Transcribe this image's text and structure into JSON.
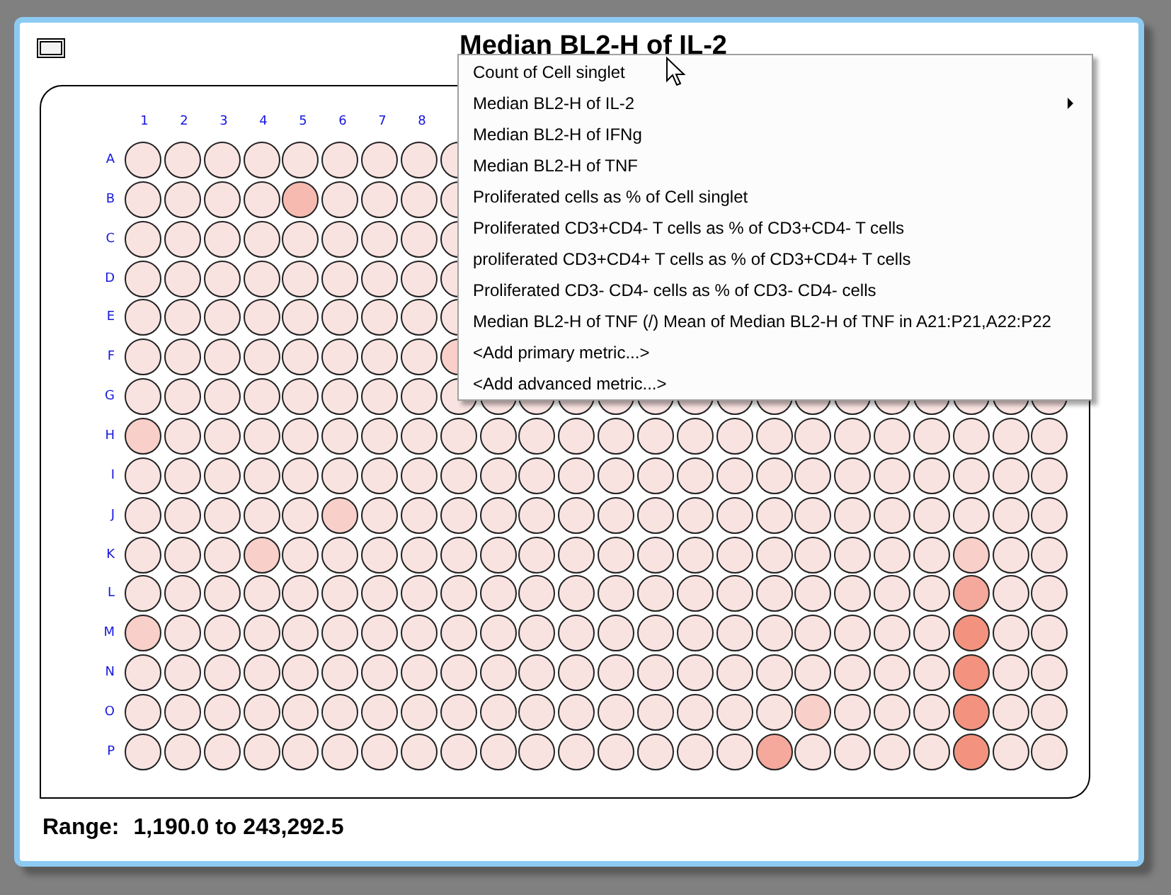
{
  "window": {
    "title": "Median BL2-H of IL-2"
  },
  "plate": {
    "column_labels": [
      "1",
      "2",
      "3",
      "4",
      "5",
      "6",
      "7",
      "8"
    ],
    "rows": [
      {
        "label": "A",
        "wells": [
          {
            "color": "#f9e3e1"
          },
          {
            "color": "#f9e3e1"
          },
          {
            "color": "#f9e3e1"
          },
          {
            "color": "#f9e3e1"
          },
          {
            "color": "#f9e3e1"
          },
          {
            "color": "#f9e3e1"
          },
          {
            "color": "#f9e3e1"
          },
          {
            "color": "#f9e3e1"
          },
          {
            "color": "#f9e3e1"
          }
        ]
      },
      {
        "label": "B",
        "wells": [
          {
            "color": "#f9e3e1"
          },
          {
            "color": "#f9e3e1"
          },
          {
            "color": "#f9e3e1"
          },
          {
            "color": "#f9e3e1"
          },
          {
            "color": "#f7bab0"
          },
          {
            "color": "#f9e3e1"
          },
          {
            "color": "#f9e3e1"
          },
          {
            "color": "#f9e3e1"
          },
          {
            "color": "#f9e3e1"
          }
        ]
      },
      {
        "label": "C",
        "wells": [
          {
            "color": "#f9e3e1"
          },
          {
            "color": "#f9e3e1"
          },
          {
            "color": "#f9e3e1"
          },
          {
            "color": "#f9e3e1"
          },
          {
            "color": "#f9e3e1"
          },
          {
            "color": "#f9e3e1"
          },
          {
            "color": "#f9e3e1"
          },
          {
            "color": "#f9e3e1"
          },
          {
            "color": "#f9e3e1"
          }
        ]
      },
      {
        "label": "D",
        "wells": [
          {
            "color": "#f9e3e1"
          },
          {
            "color": "#f9e3e1"
          },
          {
            "color": "#f9e3e1"
          },
          {
            "color": "#f9e3e1"
          },
          {
            "color": "#f9e3e1"
          },
          {
            "color": "#f9e3e1"
          },
          {
            "color": "#f9e3e1"
          },
          {
            "color": "#f9e3e1"
          },
          {
            "color": "#f9e3e1"
          }
        ]
      },
      {
        "label": "E",
        "wells": [
          {
            "color": "#f9e3e1"
          },
          {
            "color": "#f9e3e1"
          },
          {
            "color": "#f9e3e1"
          },
          {
            "color": "#f9e3e1"
          },
          {
            "color": "#f9e3e1"
          },
          {
            "color": "#f9e3e1"
          },
          {
            "color": "#f9e3e1"
          },
          {
            "color": "#f9e3e1"
          },
          {
            "color": "#f9e3e1"
          }
        ]
      },
      {
        "label": "F",
        "wells": [
          {
            "color": "#f9e3e1"
          },
          {
            "color": "#f9e3e1"
          },
          {
            "color": "#f9e3e1"
          },
          {
            "color": "#f9e3e1"
          },
          {
            "color": "#f9e3e1"
          },
          {
            "color": "#f9e3e1"
          },
          {
            "color": "#f9e3e1"
          },
          {
            "color": "#f9e3e1"
          },
          {
            "color": "#f8cfc9"
          }
        ]
      },
      {
        "label": "G",
        "wells": [
          {
            "color": "#f9e3e1"
          },
          {
            "color": "#f9e3e1"
          },
          {
            "color": "#f9e3e1"
          },
          {
            "color": "#f9e3e1"
          },
          {
            "color": "#f9e3e1"
          },
          {
            "color": "#f9e3e1"
          },
          {
            "color": "#f9e3e1"
          },
          {
            "color": "#f9e3e1"
          },
          {
            "color": "#f9e3e1"
          },
          {
            "color": "#f9e3e1"
          },
          {
            "color": "#f9e3e1"
          },
          {
            "color": "#f9e3e1"
          },
          {
            "color": "#f9e3e1"
          },
          {
            "color": "#f9e3e1"
          },
          {
            "color": "#f9e3e1"
          },
          {
            "color": "#f9e3e1"
          },
          {
            "color": "#f9e3e1"
          },
          {
            "color": "#f9e3e1"
          },
          {
            "color": "#f9e3e1"
          },
          {
            "color": "#f9e3e1"
          },
          {
            "color": "#f9e3e1"
          },
          {
            "color": "#f9e3e1"
          },
          {
            "color": "#f9e3e1"
          },
          {
            "color": "#f9e3e1"
          }
        ]
      },
      {
        "label": "H",
        "wells": [
          {
            "color": "#f8cfc9"
          },
          {
            "color": "#f9e3e1"
          },
          {
            "color": "#f9e3e1"
          },
          {
            "color": "#f9e3e1"
          },
          {
            "color": "#f9e3e1"
          },
          {
            "color": "#f9e3e1"
          },
          {
            "color": "#f9e3e1"
          },
          {
            "color": "#f9e3e1"
          },
          {
            "color": "#f9e3e1"
          },
          {
            "color": "#f9e3e1"
          },
          {
            "color": "#f9e3e1"
          },
          {
            "color": "#f9e3e1"
          },
          {
            "color": "#f9e3e1"
          },
          {
            "color": "#f9e3e1"
          },
          {
            "color": "#f9e3e1"
          },
          {
            "color": "#f9e3e1"
          },
          {
            "color": "#f9e3e1"
          },
          {
            "color": "#f9e3e1"
          },
          {
            "color": "#f9e3e1"
          },
          {
            "color": "#f9e3e1"
          },
          {
            "color": "#f9e3e1"
          },
          {
            "color": "#f9e3e1"
          },
          {
            "color": "#f9e3e1"
          },
          {
            "color": "#f9e3e1"
          }
        ]
      },
      {
        "label": "I",
        "wells": [
          {
            "color": "#f9e3e1"
          },
          {
            "color": "#f9e3e1"
          },
          {
            "color": "#f9e3e1"
          },
          {
            "color": "#f9e3e1"
          },
          {
            "color": "#f9e3e1"
          },
          {
            "color": "#f9e3e1"
          },
          {
            "color": "#f9e3e1"
          },
          {
            "color": "#f9e3e1"
          },
          {
            "color": "#f9e3e1"
          },
          {
            "color": "#f9e3e1"
          },
          {
            "color": "#f9e3e1"
          },
          {
            "color": "#f9e3e1"
          },
          {
            "color": "#f9e3e1"
          },
          {
            "color": "#f9e3e1"
          },
          {
            "color": "#f9e3e1"
          },
          {
            "color": "#f9e3e1"
          },
          {
            "color": "#f9e3e1"
          },
          {
            "color": "#f9e3e1"
          },
          {
            "color": "#f9e3e1"
          },
          {
            "color": "#f9e3e1"
          },
          {
            "color": "#f9e3e1"
          },
          {
            "color": "#f9e3e1"
          },
          {
            "color": "#f9e3e1"
          },
          {
            "color": "#f9e3e1"
          }
        ]
      },
      {
        "label": "J",
        "wells": [
          {
            "color": "#f9e3e1"
          },
          {
            "color": "#f9e3e1"
          },
          {
            "color": "#f9e3e1"
          },
          {
            "color": "#f9e3e1"
          },
          {
            "color": "#f9e3e1"
          },
          {
            "color": "#f8cfc9"
          },
          {
            "color": "#f9e3e1"
          },
          {
            "color": "#f9e3e1"
          },
          {
            "color": "#f9e3e1"
          },
          {
            "color": "#f9e3e1"
          },
          {
            "color": "#f9e3e1"
          },
          {
            "color": "#f9e3e1"
          },
          {
            "color": "#f9e3e1"
          },
          {
            "color": "#f9e3e1"
          },
          {
            "color": "#f9e3e1"
          },
          {
            "color": "#f9e3e1"
          },
          {
            "color": "#f9e3e1"
          },
          {
            "color": "#f9e3e1"
          },
          {
            "color": "#f9e3e1"
          },
          {
            "color": "#f9e3e1"
          },
          {
            "color": "#f9e3e1"
          },
          {
            "color": "#f9e3e1"
          },
          {
            "color": "#f9e3e1"
          },
          {
            "color": "#f9e3e1"
          }
        ]
      },
      {
        "label": "K",
        "wells": [
          {
            "color": "#f9e3e1"
          },
          {
            "color": "#f9e3e1"
          },
          {
            "color": "#f9e3e1"
          },
          {
            "color": "#f8cfc9"
          },
          {
            "color": "#f9e3e1"
          },
          {
            "color": "#f9e3e1"
          },
          {
            "color": "#f9e3e1"
          },
          {
            "color": "#f9e3e1"
          },
          {
            "color": "#f9e3e1"
          },
          {
            "color": "#f9e3e1"
          },
          {
            "color": "#f9e3e1"
          },
          {
            "color": "#f9e3e1"
          },
          {
            "color": "#f9e3e1"
          },
          {
            "color": "#f9e3e1"
          },
          {
            "color": "#f9e3e1"
          },
          {
            "color": "#f9e3e1"
          },
          {
            "color": "#f9e3e1"
          },
          {
            "color": "#f9e3e1"
          },
          {
            "color": "#f9e3e1"
          },
          {
            "color": "#f9e3e1"
          },
          {
            "color": "#f9e3e1"
          },
          {
            "color": "#f8cfc9"
          },
          {
            "color": "#f9e3e1"
          },
          {
            "color": "#f9e3e1"
          }
        ]
      },
      {
        "label": "L",
        "wells": [
          {
            "color": "#f9e3e1"
          },
          {
            "color": "#f9e3e1"
          },
          {
            "color": "#f9e3e1"
          },
          {
            "color": "#f9e3e1"
          },
          {
            "color": "#f9e3e1"
          },
          {
            "color": "#f9e3e1"
          },
          {
            "color": "#f9e3e1"
          },
          {
            "color": "#f9e3e1"
          },
          {
            "color": "#f9e3e1"
          },
          {
            "color": "#f9e3e1"
          },
          {
            "color": "#f9e3e1"
          },
          {
            "color": "#f9e3e1"
          },
          {
            "color": "#f9e3e1"
          },
          {
            "color": "#f9e3e1"
          },
          {
            "color": "#f9e3e1"
          },
          {
            "color": "#f9e3e1"
          },
          {
            "color": "#f9e3e1"
          },
          {
            "color": "#f9e3e1"
          },
          {
            "color": "#f9e3e1"
          },
          {
            "color": "#f9e3e1"
          },
          {
            "color": "#f9e3e1"
          },
          {
            "color": "#f5a89c"
          },
          {
            "color": "#f9e3e1"
          },
          {
            "color": "#f9e3e1"
          }
        ]
      },
      {
        "label": "M",
        "wells": [
          {
            "color": "#f8cfc9"
          },
          {
            "color": "#f9e3e1"
          },
          {
            "color": "#f9e3e1"
          },
          {
            "color": "#f9e3e1"
          },
          {
            "color": "#f9e3e1"
          },
          {
            "color": "#f9e3e1"
          },
          {
            "color": "#f9e3e1"
          },
          {
            "color": "#f9e3e1"
          },
          {
            "color": "#f9e3e1"
          },
          {
            "color": "#f9e3e1"
          },
          {
            "color": "#f9e3e1"
          },
          {
            "color": "#f9e3e1"
          },
          {
            "color": "#f9e3e1"
          },
          {
            "color": "#f9e3e1"
          },
          {
            "color": "#f9e3e1"
          },
          {
            "color": "#f9e3e1"
          },
          {
            "color": "#f9e3e1"
          },
          {
            "color": "#f9e3e1"
          },
          {
            "color": "#f9e3e1"
          },
          {
            "color": "#f9e3e1"
          },
          {
            "color": "#f9e3e1"
          },
          {
            "color": "#f3937f"
          },
          {
            "color": "#f9e3e1"
          },
          {
            "color": "#f9e3e1"
          }
        ]
      },
      {
        "label": "N",
        "wells": [
          {
            "color": "#f9e3e1"
          },
          {
            "color": "#f9e3e1"
          },
          {
            "color": "#f9e3e1"
          },
          {
            "color": "#f9e3e1"
          },
          {
            "color": "#f9e3e1"
          },
          {
            "color": "#f9e3e1"
          },
          {
            "color": "#f9e3e1"
          },
          {
            "color": "#f9e3e1"
          },
          {
            "color": "#f9e3e1"
          },
          {
            "color": "#f9e3e1"
          },
          {
            "color": "#f9e3e1"
          },
          {
            "color": "#f9e3e1"
          },
          {
            "color": "#f9e3e1"
          },
          {
            "color": "#f9e3e1"
          },
          {
            "color": "#f9e3e1"
          },
          {
            "color": "#f9e3e1"
          },
          {
            "color": "#f9e3e1"
          },
          {
            "color": "#f9e3e1"
          },
          {
            "color": "#f9e3e1"
          },
          {
            "color": "#f9e3e1"
          },
          {
            "color": "#f9e3e1"
          },
          {
            "color": "#f3937f"
          },
          {
            "color": "#f9e3e1"
          },
          {
            "color": "#f9e3e1"
          }
        ]
      },
      {
        "label": "O",
        "wells": [
          {
            "color": "#f9e3e1"
          },
          {
            "color": "#f9e3e1"
          },
          {
            "color": "#f9e3e1"
          },
          {
            "color": "#f9e3e1"
          },
          {
            "color": "#f9e3e1"
          },
          {
            "color": "#f9e3e1"
          },
          {
            "color": "#f9e3e1"
          },
          {
            "color": "#f9e3e1"
          },
          {
            "color": "#f9e3e1"
          },
          {
            "color": "#f9e3e1"
          },
          {
            "color": "#f9e3e1"
          },
          {
            "color": "#f9e3e1"
          },
          {
            "color": "#f9e3e1"
          },
          {
            "color": "#f9e3e1"
          },
          {
            "color": "#f9e3e1"
          },
          {
            "color": "#f9e3e1"
          },
          {
            "color": "#f9e3e1"
          },
          {
            "color": "#f8cfc9"
          },
          {
            "color": "#f9e3e1"
          },
          {
            "color": "#f9e3e1"
          },
          {
            "color": "#f9e3e1"
          },
          {
            "color": "#f3937f"
          },
          {
            "color": "#f9e3e1"
          },
          {
            "color": "#f9e3e1"
          }
        ]
      },
      {
        "label": "P",
        "wells": [
          {
            "color": "#f9e3e1"
          },
          {
            "color": "#f9e3e1"
          },
          {
            "color": "#f9e3e1"
          },
          {
            "color": "#f9e3e1"
          },
          {
            "color": "#f9e3e1"
          },
          {
            "color": "#f9e3e1"
          },
          {
            "color": "#f9e3e1"
          },
          {
            "color": "#f9e3e1"
          },
          {
            "color": "#f9e3e1"
          },
          {
            "color": "#f9e3e1"
          },
          {
            "color": "#f9e3e1"
          },
          {
            "color": "#f9e3e1"
          },
          {
            "color": "#f9e3e1"
          },
          {
            "color": "#f9e3e1"
          },
          {
            "color": "#f9e3e1"
          },
          {
            "color": "#f9e3e1"
          },
          {
            "color": "#f5a89c"
          },
          {
            "color": "#f9e3e1"
          },
          {
            "color": "#f9e3e1"
          },
          {
            "color": "#f9e3e1"
          },
          {
            "color": "#f9e3e1"
          },
          {
            "color": "#f3937f"
          },
          {
            "color": "#f9e3e1"
          },
          {
            "color": "#f9e3e1"
          }
        ]
      }
    ]
  },
  "range": {
    "label": "Range:",
    "value": "1,190.0 to 243,292.5"
  },
  "context_menu": {
    "items": [
      {
        "label": "Count of Cell singlet",
        "has_submenu": false
      },
      {
        "label": "Median BL2-H of IL-2",
        "has_submenu": true
      },
      {
        "label": "Median BL2-H of IFNg",
        "has_submenu": false
      },
      {
        "label": "Median BL2-H of TNF",
        "has_submenu": false
      },
      {
        "label": "Proliferated cells as % of Cell singlet",
        "has_submenu": false
      },
      {
        "label": "Proliferated CD3+CD4- T cells as % of CD3+CD4- T cells",
        "has_submenu": false
      },
      {
        "label": "proliferated CD3+CD4+ T cells as % of CD3+CD4+ T cells",
        "has_submenu": false
      },
      {
        "label": "Proliferated CD3- CD4- cells as % of CD3- CD4- cells",
        "has_submenu": false
      },
      {
        "label": "Median BL2-H of TNF (/) Mean of Median BL2-H of TNF in A21:P21,A22:P22",
        "has_submenu": false
      },
      {
        "label": "<Add primary metric...>",
        "has_submenu": false
      },
      {
        "label": "<Add advanced metric...>",
        "has_submenu": false
      }
    ]
  }
}
